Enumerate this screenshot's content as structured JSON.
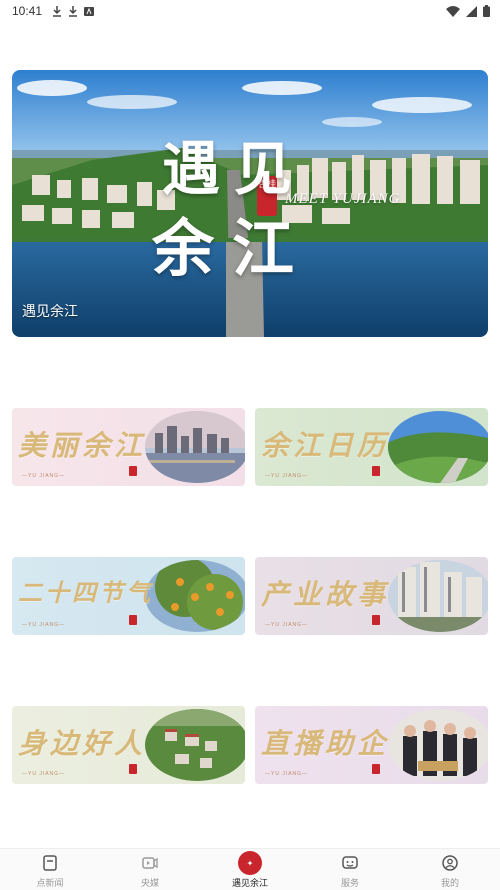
{
  "status_bar": {
    "time": "10:41"
  },
  "hero": {
    "caption": "遇见余江",
    "meet_text": "MEET YUJIANG",
    "calligraphy_line1": "遇见",
    "calligraphy_line2": "余江",
    "seal_text": "杏桂"
  },
  "cards": [
    {
      "title": "美丽余江",
      "subtitle": "—YU JIANG—"
    },
    {
      "title": "余江日历",
      "subtitle": "—YU JIANG—"
    },
    {
      "title": "二十四节气",
      "subtitle": "—YU JIANG—"
    },
    {
      "title": "产业故事",
      "subtitle": "—YU JIANG—"
    },
    {
      "title": "身边好人",
      "subtitle": "—YU JIANG—"
    },
    {
      "title": "直播助企",
      "subtitle": "—YU JIANG—"
    }
  ],
  "bottom_nav": {
    "items": [
      {
        "label": "点新闻",
        "icon": "news-icon"
      },
      {
        "label": "央媒",
        "icon": "video-icon"
      },
      {
        "label": "遇见余江",
        "icon": "yujiang-logo-icon",
        "active": true
      },
      {
        "label": "服务",
        "icon": "service-icon"
      },
      {
        "label": "我的",
        "icon": "profile-icon"
      }
    ]
  },
  "colors": {
    "accent_red": "#c8252c",
    "card_gold": "#d8b97a"
  }
}
